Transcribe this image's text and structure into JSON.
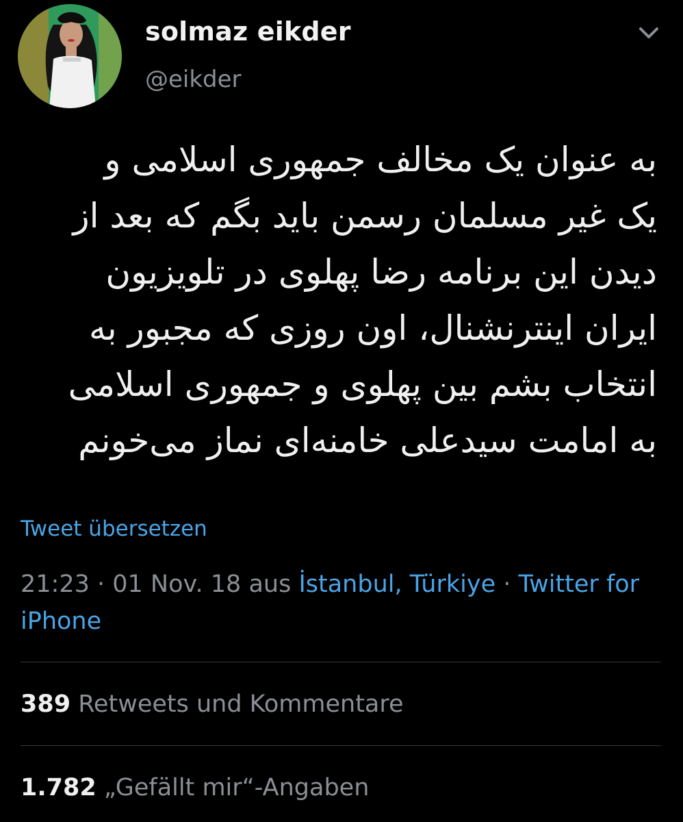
{
  "user": {
    "display_name": "solmaz eikder",
    "handle": "@eikder"
  },
  "tweet": {
    "text": "به عنوان یک مخالف جمهوری اسلامی و\nیک غیر مسلمان رسمن باید بگم که بعد از\nدیدن این برنامه رضا پهلوی در تلویزیون\nایران اینترنشنال، اون روزی که مجبور به\nانتخاب بشم بین پهلوی و جمهوری اسلامی\nبه امامت سیدعلی خامنه‌ای نماز می‌خونم",
    "translate_label": "Tweet übersetzen",
    "time": "21:23",
    "separator": " · ",
    "date": "01 Nov. 18",
    "location_prefix": " aus ",
    "location": "İstanbul, Türkiye",
    "source": "Twitter for iPhone"
  },
  "stats": {
    "retweets_count": "389",
    "retweets_label": " Retweets und Kommentare",
    "likes_count": "1.782",
    "likes_label": " „Gefällt mir“-Angaben"
  },
  "icons": {
    "menu": "chevron-down-icon"
  },
  "colors": {
    "background": "#000000",
    "link": "#4aa4e6",
    "secondary_text": "#8b8f94",
    "primary_text": "#f0f0f0"
  }
}
